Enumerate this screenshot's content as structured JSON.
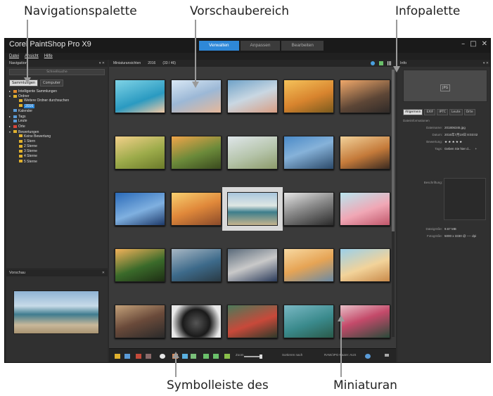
{
  "callouts": {
    "navigation_palette": "Navigationspalette",
    "preview_area": "Vorschaubereich",
    "info_palette": "Infopalette",
    "toolbar": "Symbolleiste des",
    "thumbnails": "Miniaturan"
  },
  "app": {
    "title": "Corel PaintShop Pro X9",
    "tabs": [
      "Verwalten",
      "Anpassen",
      "Bearbeiten"
    ],
    "active_tab": "Verwalten",
    "menu": [
      "Datei",
      "Ansicht",
      "Hilfe"
    ],
    "window_controls": [
      "–",
      "□",
      "✕"
    ]
  },
  "navigation": {
    "header": "Navigation",
    "search_placeholder": "Schnellsuche",
    "tabs": [
      "Sammlungen",
      "Computer"
    ],
    "tree": [
      {
        "label": "Intelligente Sammlungen",
        "icon": "smart-collection-icon",
        "color": "#e08a2e"
      },
      {
        "label": "Ordner",
        "icon": "folder-icon",
        "color": "#e0b12e"
      },
      {
        "label": "Weitere Ordner durchsuchen",
        "icon": "folder-add-icon",
        "color": "#e0b12e"
      },
      {
        "label": "2016",
        "icon": "folder-icon",
        "color": "#e0b12e",
        "selected": true
      },
      {
        "label": "Kalender",
        "icon": "calendar-icon",
        "color": "#5a9bd8"
      },
      {
        "label": "Tags",
        "icon": "tag-icon",
        "color": "#5a9bd8"
      },
      {
        "label": "Leute",
        "icon": "people-icon",
        "color": "#5a9bd8"
      },
      {
        "label": "Orte",
        "icon": "pin-icon",
        "color": "#d8453a"
      },
      {
        "label": "Bewertungen",
        "icon": "star-icon",
        "color": "#e0b12e"
      },
      {
        "label": "Keine Bewertung",
        "icon": "star-icon",
        "color": "#e0b12e"
      },
      {
        "label": "1 Stern",
        "icon": "star-icon",
        "color": "#e0b12e"
      },
      {
        "label": "2 Sterne",
        "icon": "star-icon",
        "color": "#e0b12e"
      },
      {
        "label": "3 Sterne",
        "icon": "star-icon",
        "color": "#e0b12e"
      },
      {
        "label": "4 Sterne",
        "icon": "star-icon",
        "color": "#e0b12e"
      },
      {
        "label": "5 Sterne",
        "icon": "star-icon",
        "color": "#e0b12e"
      }
    ]
  },
  "preview": {
    "header": "Vorschau"
  },
  "browser": {
    "header_label": "Miniaturansichten",
    "folder": "2016",
    "count": "(33 / 46)",
    "toolbar": {
      "zoom_label": "Zoom",
      "sort_label": "Sortieren nach",
      "raw_label": "RAW/JPG-Paare: AUS"
    },
    "thumbnails": [
      {
        "gradient": "linear-gradient(160deg,#7fd3e6,#2a9ac1 60%,#f2c9a5)"
      },
      {
        "gradient": "linear-gradient(160deg,#d9e8f5,#9cb8d6 50%,#e6b89a)"
      },
      {
        "gradient": "linear-gradient(160deg,#6fa2c8,#c9d7e2 50%,#d89e84)"
      },
      {
        "gradient": "linear-gradient(160deg,#f5c25a,#d8842e 55%,#7a5a1e)"
      },
      {
        "gradient": "linear-gradient(160deg,#f0a86a,#5d4636 60%,#2f2a28)"
      },
      {
        "gradient": "linear-gradient(160deg,#f3d08a,#9cab4a 55%,#6b7a2a)"
      },
      {
        "gradient": "linear-gradient(160deg,#f1a54a,#6b8a3a 55%,#3a4a1e)"
      },
      {
        "gradient": "linear-gradient(160deg,#dfe6ea,#b5c4aa 55%,#8c9a6a)"
      },
      {
        "gradient": "linear-gradient(160deg,#4a8ac8,#86b2d9 45%,#2c4a6a)"
      },
      {
        "gradient": "linear-gradient(160deg,#f2d29a,#c47a3a 55%,#3a2a20)"
      },
      {
        "gradient": "linear-gradient(160deg,#2a6ab8,#7fb0e0 55%,#1e3a6a)"
      },
      {
        "gradient": "linear-gradient(160deg,#f8d070,#e0883a 50%,#8a4a2a)"
      },
      {
        "gradient": "linear-gradient(180deg,#a9c6dd,#dfe7e4 40%,#3d7e8c 60%,#c6b58f)"
      },
      {
        "gradient": "linear-gradient(160deg,#e6e6e6,#8c8c8c 45%,#2a2a2a)"
      },
      {
        "gradient": "linear-gradient(160deg,#b9e6ef,#f0a7b5 55%,#c0566a)"
      },
      {
        "gradient": "linear-gradient(160deg,#f2b25a,#3a6a2a 55%,#1e2e14)"
      },
      {
        "gradient": "linear-gradient(160deg,#a8b7c4,#3d6a8a 55%,#2a3a44)"
      },
      {
        "gradient": "linear-gradient(160deg,#5a6a7a,#c9c9c9 50%,#2a3a5a)"
      },
      {
        "gradient": "linear-gradient(160deg,#f7d9a2,#e6a455 50%,#6a8aa5)"
      },
      {
        "gradient": "linear-gradient(160deg,#9bd0ea,#f2d39a 55%,#c98a4a)"
      },
      {
        "gradient": "linear-gradient(160deg,#c4a27a,#6a4a3a 50%,#2a2a2a)"
      },
      {
        "gradient": "radial-gradient(circle at 50% 55%,#555 0%,#1a1a1a 45%,#e8e8e8 80%)"
      },
      {
        "gradient": "linear-gradient(160deg,#4a7a5a,#c8493a 55%,#2e3a2a)"
      },
      {
        "gradient": "linear-gradient(160deg,#7ab8c4,#3a8a8c 55%,#2a5a4a)"
      },
      {
        "gradient": "linear-gradient(160deg,#e8c0c8,#c44a6a 45%,#2a4a3a)"
      }
    ]
  },
  "info": {
    "header": "Info",
    "format": "JPG",
    "tabs": [
      "Allgemein",
      "EXIF",
      "IPTC",
      "Leute",
      "Orte"
    ],
    "section_title": "Dateiinformationen",
    "fields": [
      {
        "key": "Dateiname:",
        "value": "201806345.jpg"
      },
      {
        "key": "Datum:",
        "value": "2016年7月19日 8:03:02"
      },
      {
        "key": "Bewertung:",
        "value": "★ ★ ★ ★ ★"
      },
      {
        "key": "Tags:",
        "value": "Geben Sie hier d..."
      },
      {
        "key": "Beschriftung:",
        "value": ""
      },
      {
        "key": "Dateigröße:",
        "value": "9.67 MB"
      },
      {
        "key": "Fotogröße:",
        "value": "5000 x 3330 @ ---- dpi"
      }
    ]
  },
  "colors": {
    "accent": "#2e88d8",
    "panel_bg": "#303030",
    "window_bg": "#2a2a2a"
  }
}
